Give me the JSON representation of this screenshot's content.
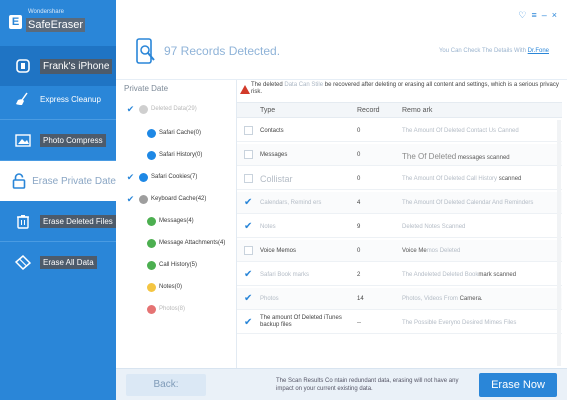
{
  "app": {
    "brand_small": "Wondershare",
    "brand_name": "SafeEraser"
  },
  "window": {
    "controls": [
      "♡",
      "≡",
      "–",
      "×"
    ]
  },
  "sidebar": {
    "device": "Frank's iPhone",
    "items": [
      {
        "label": "Express Cleanup",
        "icon": "broom-icon"
      },
      {
        "label": "Photo Compress",
        "icon": "photo-icon"
      },
      {
        "label": "Erase Private Date",
        "icon": "lock-icon"
      },
      {
        "label": "Erase Deleted Files",
        "icon": "trash-icon"
      },
      {
        "label": "Erase All Data",
        "icon": "eraser-icon"
      }
    ]
  },
  "header": {
    "title": "97 Records Detected.",
    "hint_prefix": "You Can Check The Details With",
    "hint_link": "Dr.Fone"
  },
  "tree": {
    "title": "Private Date",
    "items": [
      {
        "label": "Deleted Data(29)",
        "checked": true,
        "dim": true,
        "color": "#cfcfcf"
      },
      {
        "label": "Safari Cache(0)",
        "checked": false,
        "dim": false,
        "color": "#1e88e5"
      },
      {
        "label": "Safari History(0)",
        "checked": false,
        "dim": false,
        "color": "#1e88e5"
      },
      {
        "label": "Safari Cookies(7)",
        "checked": true,
        "dim": false,
        "color": "#1e88e5"
      },
      {
        "label": "Keyboard Cache(42)",
        "checked": true,
        "dim": false,
        "color": "#9e9e9e"
      },
      {
        "label": "Messages(4)",
        "checked": false,
        "dim": false,
        "color": "#4caf50"
      },
      {
        "label": "Message Attachments(4)",
        "checked": false,
        "dim": false,
        "color": "#4caf50"
      },
      {
        "label": "Call History(5)",
        "checked": false,
        "dim": false,
        "color": "#4caf50"
      },
      {
        "label": "Notes(0)",
        "checked": false,
        "dim": false,
        "color": "#f4c542"
      },
      {
        "label": "Photos(8)",
        "checked": false,
        "dim": true,
        "color": "#e57373"
      }
    ]
  },
  "warning": {
    "pre": "The deleted",
    "faded": "Data Can Stile",
    "post": "be recovered after deleting or erasing all content and settings, which is a serious privacy risk."
  },
  "table": {
    "headers": [
      "Type",
      "Record",
      "Remo ark"
    ],
    "rows": [
      {
        "checked": false,
        "type": "Contacts",
        "type_style": "",
        "record": "0",
        "remark": "The Amount Of Deleted Contact Us Canned",
        "remark_style": "faded"
      },
      {
        "checked": false,
        "type": "Messages",
        "type_style": "",
        "record": "0",
        "remark_big": "The Of Deleted",
        "remark": " messages scanned",
        "remark_style": ""
      },
      {
        "checked": false,
        "type": "Collistar",
        "type_style": "bigfade",
        "record": "0",
        "remark": "The Amount Of Deleted Call History",
        "remark_tail": " scanned",
        "remark_style": "faded"
      },
      {
        "checked": true,
        "type": "Calendars, Remind ers",
        "type_style": "faded",
        "record": "4",
        "remark": "The Amount Of Deleted Calendar And Reminders",
        "remark_style": "faded"
      },
      {
        "checked": true,
        "type": "Notes",
        "type_style": "faded",
        "record": "9",
        "remark": "Deleted Notes Scanned",
        "remark_style": "faded"
      },
      {
        "checked": false,
        "type": "Voice Memos",
        "type_style": "",
        "record": "0",
        "remark": "Voice Me",
        "remark_tail": "mos Deleted",
        "remark_style": "tailfade"
      },
      {
        "checked": true,
        "type": "Safari Book marks",
        "type_style": "faded",
        "record": "2",
        "remark": "The And",
        "remark_tail": "eleted Deleted Book",
        "remark_end": "mark scanned",
        "remark_style": "mixed"
      },
      {
        "checked": true,
        "type": "Photos",
        "type_style": "faded",
        "record": "14",
        "remark": "Photos, Videos From",
        "remark_tail": " Camera.",
        "remark_style": "headfade"
      },
      {
        "checked": true,
        "type": "The amount Of Deleted iTunes backup files",
        "type_style": "twoline",
        "record": "--",
        "remark": "The Possible Everyno Desired Mimes Files",
        "remark_style": "faded"
      }
    ]
  },
  "footer": {
    "back": "Back:",
    "message": "The Scan Results Co ntain redundant data, erasing will not have any impact on your current existing data.",
    "erase": "Erase Now"
  },
  "colors": {
    "accent": "#2a86d8",
    "sidebar": "#2a86d8",
    "warning": "#d23a2a"
  }
}
